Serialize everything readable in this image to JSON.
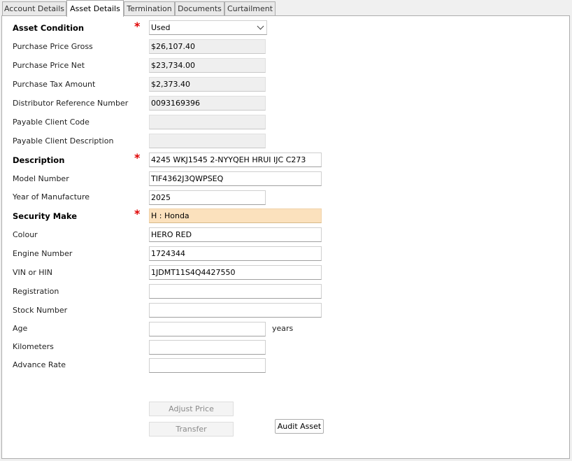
{
  "tabs": [
    {
      "label": "Account Details",
      "active": false
    },
    {
      "label": "Asset Details",
      "active": true
    },
    {
      "label": "Termination",
      "active": false
    },
    {
      "label": "Documents",
      "active": false
    },
    {
      "label": "Curtailment",
      "active": false
    }
  ],
  "required_marker": "*",
  "fields": {
    "asset_condition": {
      "label": "Asset Condition",
      "value": "Used"
    },
    "purchase_price_gross": {
      "label": "Purchase Price Gross",
      "value": "$26,107.40"
    },
    "purchase_price_net": {
      "label": "Purchase Price Net",
      "value": "$23,734.00"
    },
    "purchase_tax_amount": {
      "label": "Purchase Tax Amount",
      "value": "$2,373.40"
    },
    "distributor_reference_number": {
      "label": "Distributor Reference Number",
      "value": "0093169396"
    },
    "payable_client_code": {
      "label": "Payable Client Code",
      "value": ""
    },
    "payable_client_description": {
      "label": "Payable Client Description",
      "value": ""
    },
    "description": {
      "label": "Description",
      "value": "4245 WKJ1545 2-NYYQEH HRUI IJC C273"
    },
    "model_number": {
      "label": "Model Number",
      "value": "TIF4362J3QWPSEQ"
    },
    "year_of_manufacture": {
      "label": "Year of Manufacture",
      "value": "2025"
    },
    "security_make": {
      "label": "Security Make",
      "value": "H : Honda"
    },
    "colour": {
      "label": "Colour",
      "value": "HERO RED"
    },
    "engine_number": {
      "label": "Engine Number",
      "value": "1724344"
    },
    "vin_or_hin": {
      "label": "VIN or HIN",
      "value": "1JDMT11S4Q4427550"
    },
    "registration": {
      "label": "Registration",
      "value": ""
    },
    "stock_number": {
      "label": "Stock Number",
      "value": ""
    },
    "age": {
      "label": "Age",
      "value": "",
      "unit": "years"
    },
    "kilometers": {
      "label": "Kilometers",
      "value": ""
    },
    "advance_rate": {
      "label": "Advance Rate",
      "value": ""
    }
  },
  "buttons": {
    "adjust_price": "Adjust Price",
    "transfer": "Transfer",
    "audit_asset": "Audit Asset"
  },
  "colors": {
    "required": "#e00000",
    "highlight": "#fbe1bd",
    "readonly": "#efefef"
  }
}
